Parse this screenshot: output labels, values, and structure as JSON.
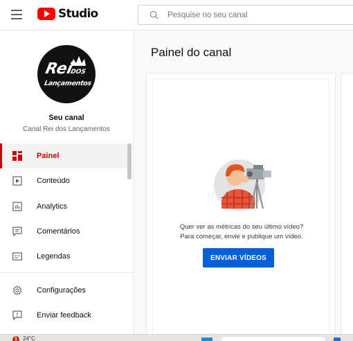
{
  "app": {
    "brand": "Studio"
  },
  "header": {
    "search_placeholder": "Pesquise no seu canal"
  },
  "channel": {
    "title": "Seu canal",
    "name": "Canal Rei dos Lançamentos",
    "avatar_lines": [
      "Rei",
      "DOS",
      "Lançamentos"
    ]
  },
  "nav": [
    {
      "label": "Painel",
      "icon": "dashboard-icon",
      "active": true
    },
    {
      "label": "Conteúdo",
      "icon": "content-icon",
      "active": false
    },
    {
      "label": "Analytics",
      "icon": "analytics-icon",
      "active": false
    },
    {
      "label": "Comentários",
      "icon": "comments-icon",
      "active": false
    },
    {
      "label": "Legendas",
      "icon": "subtitles-icon",
      "active": false
    },
    {
      "label": "Configurações",
      "icon": "settings-icon",
      "active": false
    },
    {
      "label": "Enviar feedback",
      "icon": "feedback-icon",
      "active": false
    }
  ],
  "main": {
    "title": "Painel do canal",
    "card": {
      "line1": "Quer ver as métricas do seu último vídeo?",
      "line2": "Para começar, envie e publique um vídeo.",
      "button": "ENVIAR VÍDEOS"
    }
  },
  "taskbar": {
    "badge": "1",
    "temperature": "24°C"
  },
  "colors": {
    "brand_red": "#ff0000",
    "active_red": "#cc0000",
    "cta_blue": "#065fd4"
  }
}
